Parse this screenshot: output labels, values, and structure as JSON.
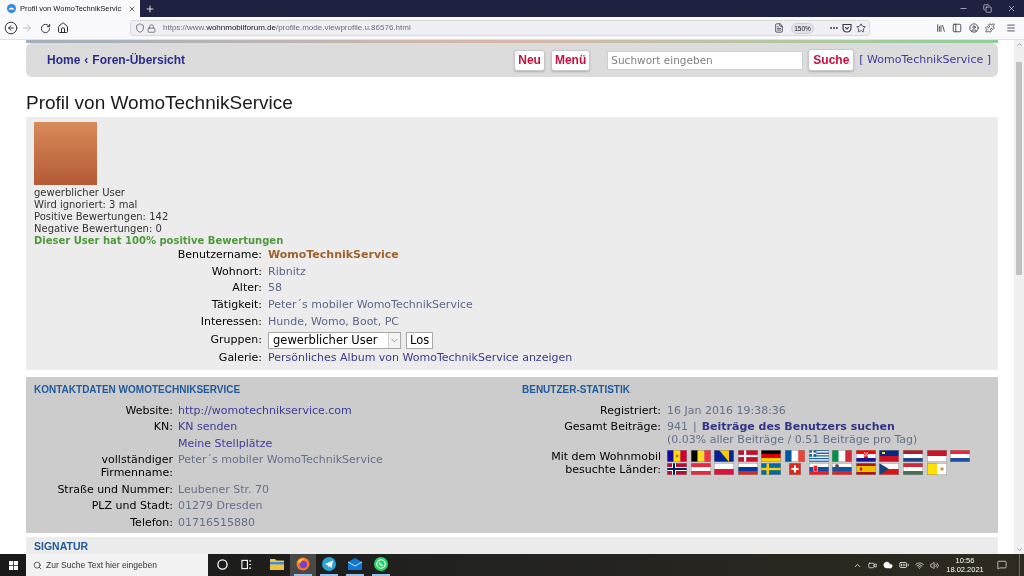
{
  "browser": {
    "tabs": [
      {
        "title": "Profil von WomoTechnikServic",
        "selected": true
      }
    ],
    "nav_buttons": [
      {
        "kind": "back",
        "disabled": false
      },
      {
        "kind": "forward",
        "disabled": true
      },
      {
        "kind": "reload",
        "disabled": false
      },
      {
        "kind": "home",
        "disabled": false
      }
    ],
    "url": {
      "scheme": "https://www.",
      "domain": "wohnmobilforum.de",
      "path": "/profile.mode.viewprofile.u.86576.html"
    },
    "zoom": "150%"
  },
  "forum_nav": {
    "breadcrumb": [
      {
        "label": "Home"
      },
      {
        "label": "Foren-Übersicht"
      }
    ],
    "separator": "‹",
    "buttons": [
      {
        "label": "Neu"
      },
      {
        "label": "Menü"
      }
    ],
    "search": {
      "placeholder": "Suchwort eingeben"
    },
    "search_button": "Suche",
    "account_link": "[ WomoTechnikService ]"
  },
  "page_title": "Profil von WomoTechnikService",
  "profile": {
    "summary": [
      "gewerblicher User",
      "Wird ignoriert: 3 mal",
      "Positive Bewertungen: 142",
      "Negative Bewertungen: 0"
    ],
    "rating_note": "Dieser User hat 100% positive Bewertungen",
    "fields": [
      {
        "kind": "name",
        "label": "Benutzername:",
        "value": "WomoTechnikService"
      },
      {
        "kind": "text",
        "label": "Wohnort:",
        "value": "Ribnitz"
      },
      {
        "kind": "text",
        "label": "Alter:",
        "value": "58"
      },
      {
        "kind": "text",
        "label": "Tätigkeit:",
        "value": "Peter´s mobiler WomoTechnikService"
      },
      {
        "kind": "text",
        "label": "Interessen:",
        "value": "Hunde, Womo, Boot, PC"
      },
      {
        "kind": "select",
        "label": "Gruppen:",
        "value": "gewerblicher User",
        "button": "Los"
      },
      {
        "kind": "link",
        "label": "Galerie:",
        "value": "Persönliches Album von WomoTechnikService anzeigen"
      }
    ]
  },
  "contact": {
    "heading": "KONTAKTDATEN WOMOTECHNIKSERVICE",
    "fields": [
      {
        "kind": "link",
        "label": "Website:",
        "value": "http://womotechnikservice.com"
      },
      {
        "kind": "link",
        "label": "KN:",
        "value": "KN senden"
      },
      {
        "kind": "link",
        "value": "Meine Stellplätze"
      },
      {
        "kind": "text",
        "label": "vollständiger Firmenname:",
        "value": "Peter´s mobiler WomoTechnikService"
      },
      {
        "kind": "text",
        "label": "Straße und Nummer:",
        "value": "Leubener Str. 70"
      },
      {
        "kind": "text",
        "label": "PLZ und Stadt:",
        "value": "01279 Dresden"
      },
      {
        "kind": "text",
        "label": "Telefon:",
        "value": "01716515880"
      }
    ]
  },
  "statistics": {
    "heading": "BENUTZER-STATISTIK",
    "rows": [
      {
        "kind": "text",
        "label": "Registriert:",
        "value": "16 Jan 2016 19:38:36"
      },
      {
        "kind": "posts",
        "label": "Gesamt Beiträge:",
        "count": "941",
        "separator": "|",
        "link": "Beiträge des Benutzers suchen",
        "note": "(0.03% aller Beiträge / 0.51 Beiträge pro Tag)"
      },
      {
        "kind": "flags",
        "label": "Mit dem Wohnmobil besuchte Länder:",
        "countries": [
          {
            "kind": "andorra"
          },
          {
            "kind": "belgium"
          },
          {
            "kind": "bosnia"
          },
          {
            "kind": "denmark"
          },
          {
            "kind": "germany"
          },
          {
            "kind": "france"
          },
          {
            "kind": "greece"
          },
          {
            "kind": "italy"
          },
          {
            "kind": "croatia"
          },
          {
            "kind": "liechtenstein"
          },
          {
            "kind": "netherlands"
          },
          {
            "kind": "monaco"
          },
          {
            "kind": "luxembourg"
          },
          {
            "kind": "norway"
          },
          {
            "kind": "austria"
          },
          {
            "kind": "poland"
          },
          {
            "kind": "russia"
          },
          {
            "kind": "sweden"
          },
          {
            "kind": "switzerland"
          },
          {
            "kind": "slovakia"
          },
          {
            "kind": "slovenia"
          },
          {
            "kind": "spain"
          },
          {
            "kind": "czechia"
          },
          {
            "kind": "hungary"
          },
          {
            "kind": "vatican"
          }
        ]
      }
    ]
  },
  "signature": {
    "heading": "SIGNATUR"
  },
  "taskbar": {
    "search": {
      "placeholder": "Zur Suche Text hier eingeben"
    },
    "apps": [
      {
        "kind": "cortana",
        "running": false,
        "selected": false
      },
      {
        "kind": "taskview",
        "running": false,
        "selected": false
      },
      {
        "kind": "explorer",
        "running": false,
        "selected": false
      },
      {
        "kind": "firefox",
        "running": true,
        "selected": true
      },
      {
        "kind": "telegram",
        "running": true,
        "selected": false
      },
      {
        "kind": "mail",
        "running": true,
        "selected": false
      },
      {
        "kind": "whatsapp",
        "running": true,
        "selected": false
      }
    ],
    "clock": {
      "time": "10:56",
      "date": "18.02.2021"
    }
  }
}
